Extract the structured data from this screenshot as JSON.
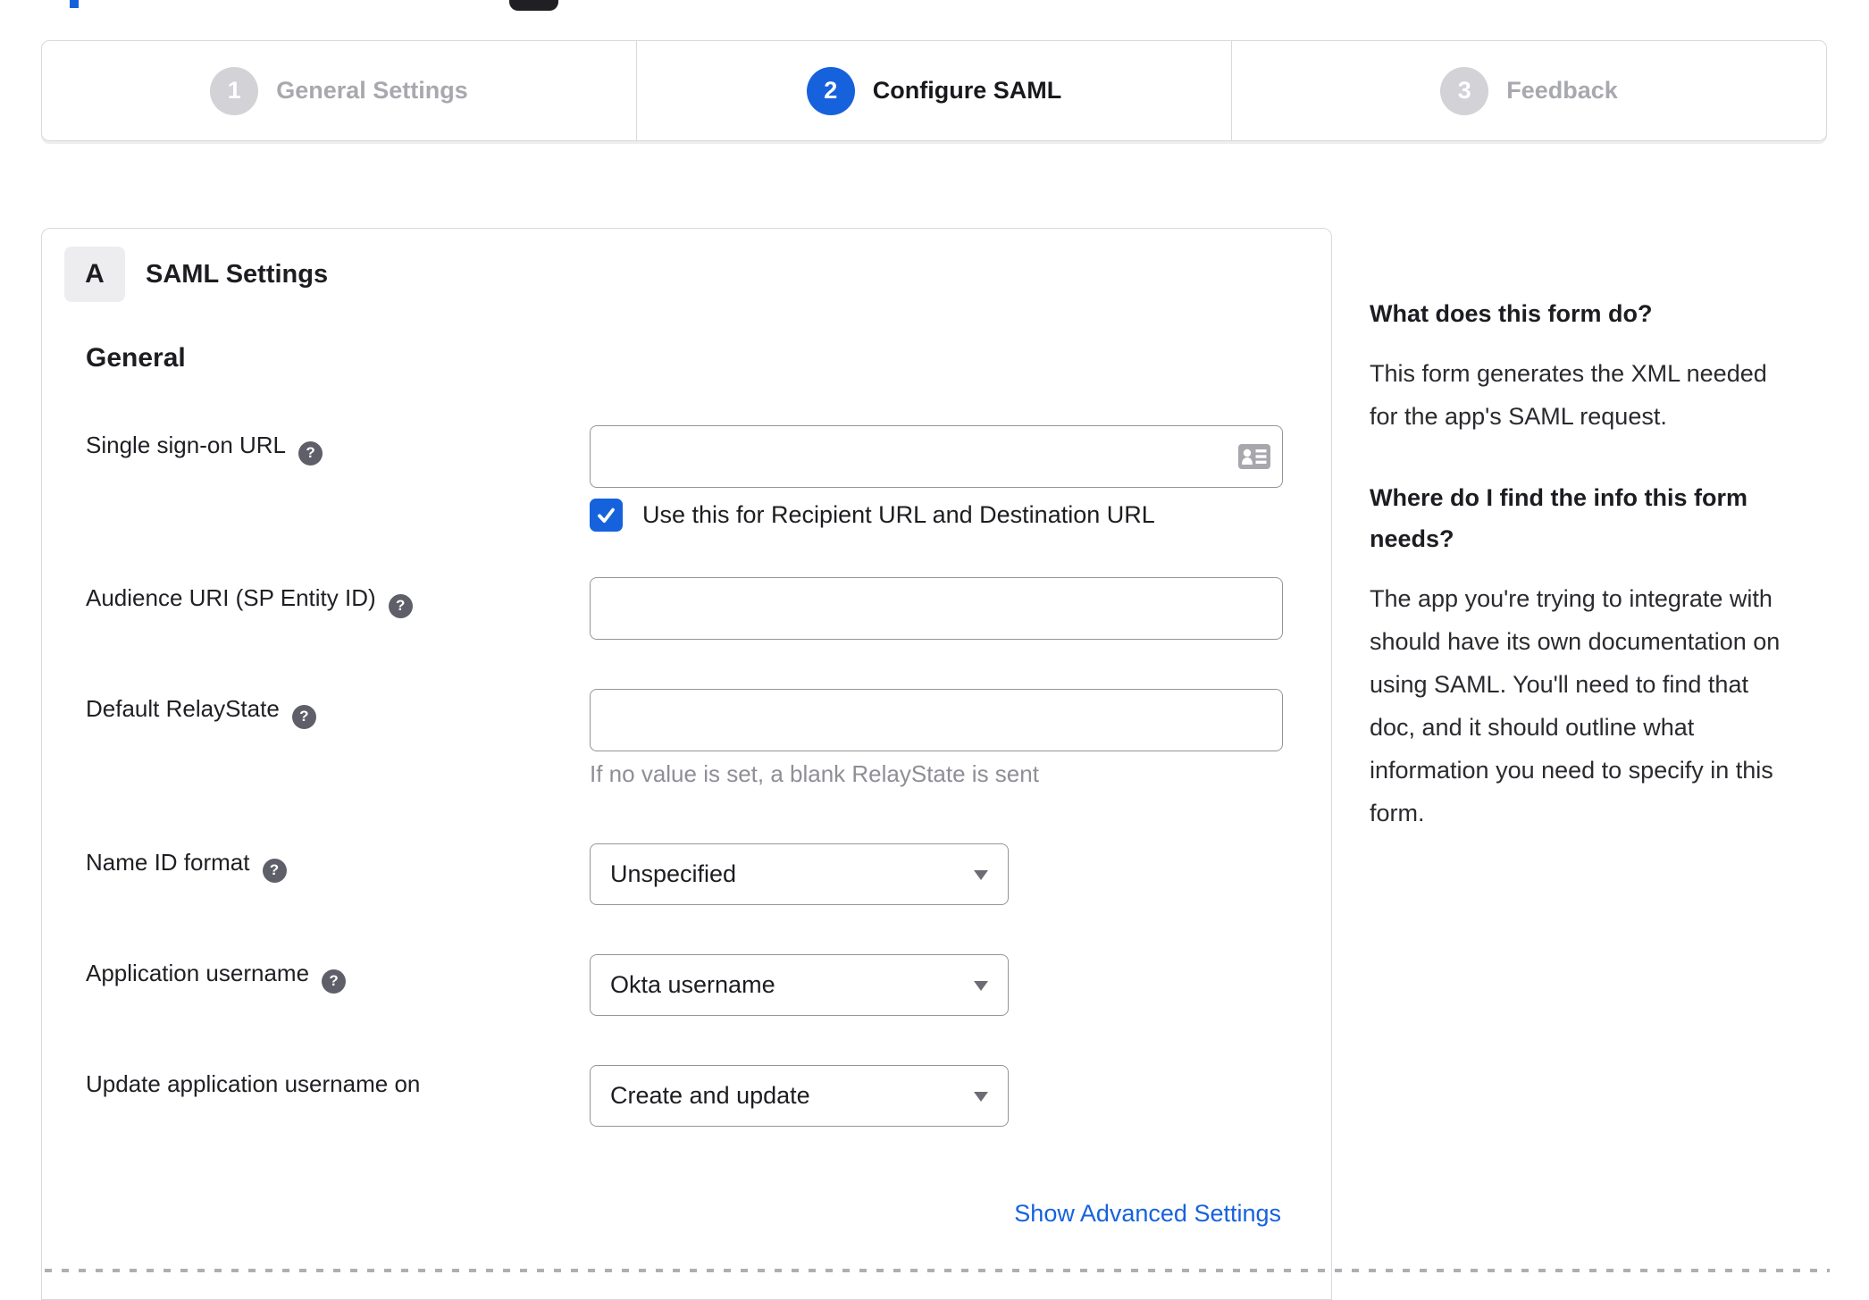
{
  "stepper": {
    "active_step": 2,
    "steps": [
      {
        "number": "1",
        "label": "General Settings"
      },
      {
        "number": "2",
        "label": "Configure SAML"
      },
      {
        "number": "3",
        "label": "Feedback"
      }
    ]
  },
  "panel": {
    "badge": "A",
    "title": "SAML Settings",
    "section": "General",
    "help_icon": "?",
    "rows": [
      {
        "label": "Single sign-on URL",
        "value": "",
        "checkbox_label": "Use this for Recipient URL and Destination URL",
        "checkbox_checked": true
      },
      {
        "label": "Audience URI (SP Entity ID)",
        "value": ""
      },
      {
        "label": "Default RelayState",
        "value": "",
        "hint": "If no value is set, a blank RelayState is sent"
      },
      {
        "label": "Name ID format",
        "value": "Unspecified"
      },
      {
        "label": "Application username",
        "value": "Okta username"
      },
      {
        "label": "Update application username on",
        "value": "Create and update"
      }
    ],
    "advanced_link": "Show Advanced Settings"
  },
  "sidebar": {
    "sections": [
      {
        "heading": "What does this form do?",
        "body": "This form generates the XML needed\nfor the app's SAML request."
      },
      {
        "heading": "Where do I find the info this form\nneeds?",
        "body": "The app you're trying to integrate with\nshould have its own documentation on\nusing SAML. You'll need to find that\ndoc, and it should outline what\ninformation you need to specify in this\nform."
      }
    ]
  },
  "colors": {
    "accent_blue": "#1662dd",
    "inactive_gray": "#a8a8af",
    "border_gray": "#d9d9dd",
    "input_border": "#94949c"
  }
}
